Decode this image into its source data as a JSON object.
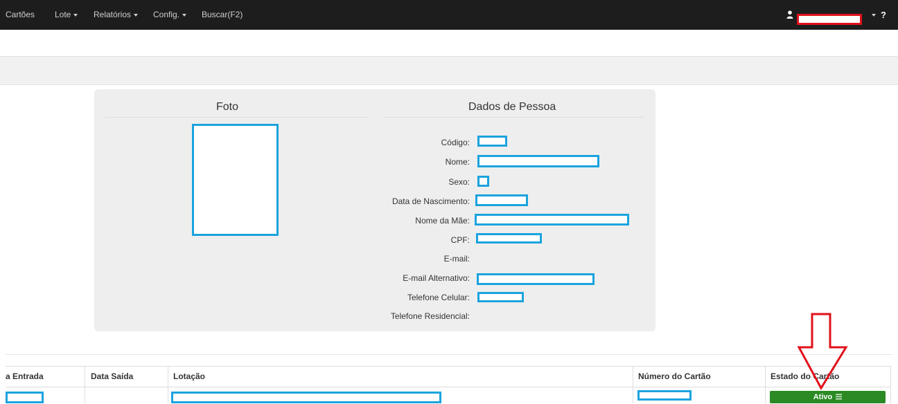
{
  "navbar": {
    "items": [
      {
        "label": "Cartões",
        "has_caret": false
      },
      {
        "label": "Lote",
        "has_caret": true
      },
      {
        "label": "Relatórios",
        "has_caret": true
      },
      {
        "label": "Config.",
        "has_caret": true
      },
      {
        "label": "Buscar(F2)",
        "has_caret": false
      }
    ],
    "user_icon": "user-icon",
    "help_label": "?"
  },
  "card": {
    "photo_title": "Foto",
    "person_title": "Dados de Pessoa",
    "fields": [
      {
        "label": "Código:",
        "redacted": true
      },
      {
        "label": "Nome:",
        "redacted": true
      },
      {
        "label": "Sexo:",
        "redacted": true
      },
      {
        "label": "Data de Nascimento:",
        "redacted": true
      },
      {
        "label": "Nome da Mãe:",
        "redacted": true
      },
      {
        "label": "CPF:",
        "redacted": true
      },
      {
        "label": "E-mail:",
        "redacted": false
      },
      {
        "label": "E-mail Alternativo:",
        "redacted": true
      },
      {
        "label": "Telefone Celular:",
        "redacted": true
      },
      {
        "label": "Telefone Residencial:",
        "redacted": false
      }
    ]
  },
  "table": {
    "columns": [
      "a Entrada",
      "Data Saída",
      "Lotação",
      "Número do Cartão",
      "Estado do Cartão"
    ],
    "status_label": "Ativo",
    "status_icon": "list-icon"
  },
  "colors": {
    "navbar": "#1d1d1d",
    "redaction_blue": "#1aa3de",
    "redaction_red": "#e0101a",
    "status_green": "#2b8a24",
    "arrow_red": "#e0101a"
  }
}
